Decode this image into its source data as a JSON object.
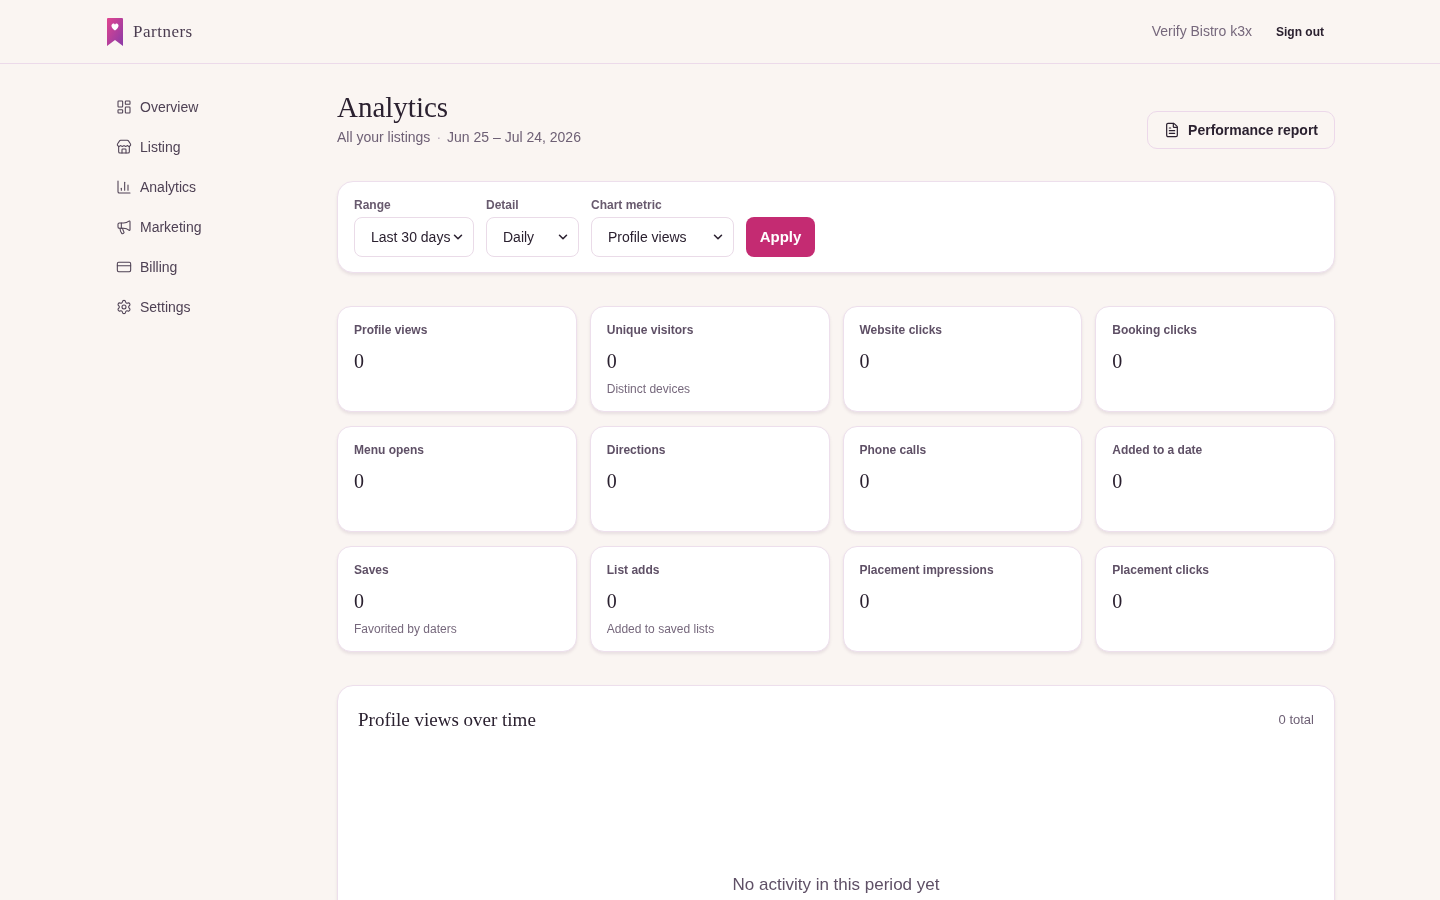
{
  "header": {
    "brand": "Partners",
    "account": "Verify Bistro k3x",
    "sign_out": "Sign out"
  },
  "sidebar": {
    "items": [
      {
        "label": "Overview"
      },
      {
        "label": "Listing"
      },
      {
        "label": "Analytics"
      },
      {
        "label": "Marketing"
      },
      {
        "label": "Billing"
      },
      {
        "label": "Settings"
      }
    ]
  },
  "page": {
    "title": "Analytics",
    "scope": "All your listings",
    "separator": "·",
    "date_range": "Jun 25 – Jul 24, 2026",
    "report_button": "Performance report"
  },
  "filters": {
    "fields": [
      {
        "label": "Range",
        "value": "Last 30 days"
      },
      {
        "label": "Detail",
        "value": "Daily"
      },
      {
        "label": "Chart metric",
        "value": "Profile views"
      }
    ],
    "apply_button": "Apply"
  },
  "stats": [
    {
      "label": "Profile views",
      "value": "0"
    },
    {
      "label": "Unique visitors",
      "value": "0",
      "note": "Distinct devices"
    },
    {
      "label": "Website clicks",
      "value": "0"
    },
    {
      "label": "Booking clicks",
      "value": "0"
    },
    {
      "label": "Menu opens",
      "value": "0"
    },
    {
      "label": "Directions",
      "value": "0"
    },
    {
      "label": "Phone calls",
      "value": "0"
    },
    {
      "label": "Added to a date",
      "value": "0"
    },
    {
      "label": "Saves",
      "value": "0",
      "note": "Favorited by daters"
    },
    {
      "label": "List adds",
      "value": "0",
      "note": "Added to saved lists"
    },
    {
      "label": "Placement impressions",
      "value": "0"
    },
    {
      "label": "Placement clicks",
      "value": "0"
    }
  ],
  "chart_card": {
    "title": "Profile views over time",
    "total": "0 total",
    "empty_message": "No activity in this period yet"
  }
}
